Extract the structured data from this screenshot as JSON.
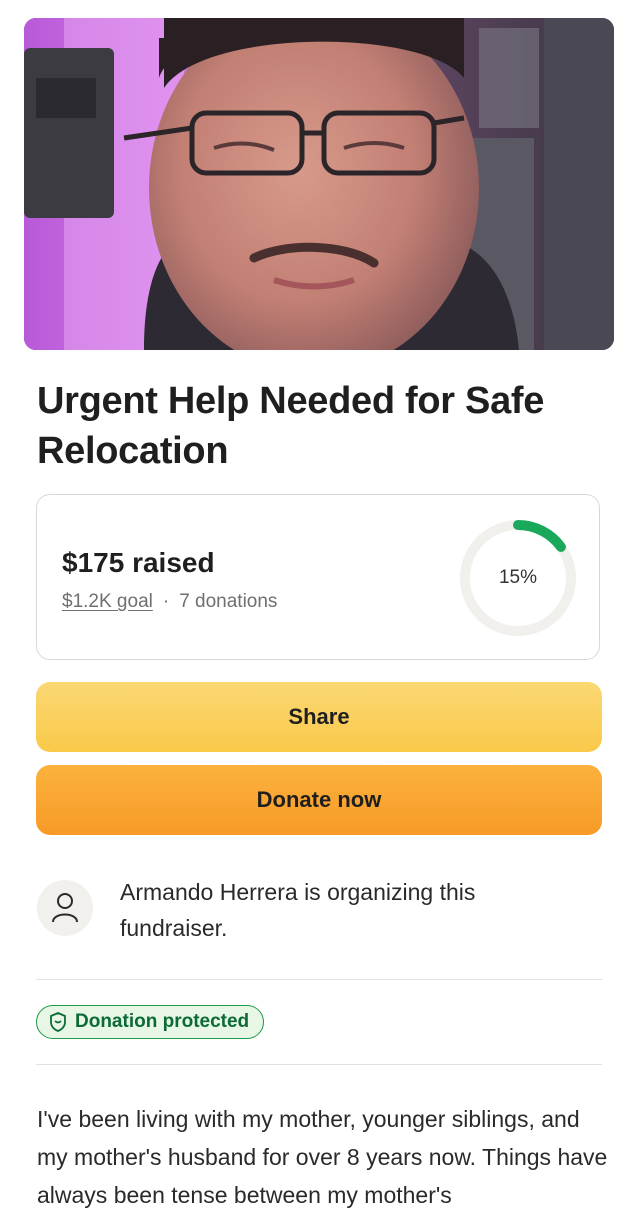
{
  "campaign": {
    "title": "Urgent Help Needed for Safe Relocation"
  },
  "progress": {
    "raised_text": "$175 raised",
    "goal_text": "$1.2K goal",
    "separator": "·",
    "donations_text": "7 donations",
    "percent_label": "15%",
    "percent_value": 0.15,
    "ring_color": "#1aa85a",
    "track_color": "#f1f0ec"
  },
  "actions": {
    "share_label": "Share",
    "donate_label": "Donate now"
  },
  "organizer": {
    "text": "Armando Herrera is organizing this fundraiser.",
    "avatar_icon": "user-icon"
  },
  "badge": {
    "label": "Donation protected",
    "icon": "shield-icon",
    "color": "#1a9a4a"
  },
  "story": {
    "text": "I've been living with my mother, younger siblings, and my mother's husband for over 8 years now. Things have always been tense between my mother's"
  }
}
